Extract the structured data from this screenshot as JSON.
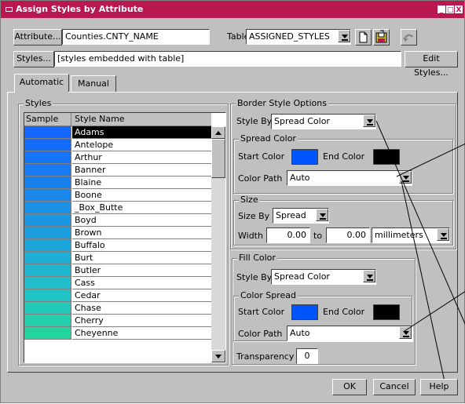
{
  "window": {
    "title": "Assign Styles by Attribute",
    "minimize_glyph": "_",
    "maximize_glyph": "□",
    "close_glyph": "X"
  },
  "top": {
    "attribute_button": "Attribute...",
    "attribute_value": "Counties.CNTY_NAME",
    "table_label": "Table",
    "table_value": "ASSIGNED_STYLES",
    "styles_button": "Styles...",
    "styles_value": "[styles embedded with table]",
    "edit_styles_button": "Edit Styles..."
  },
  "tabs": [
    {
      "label": "Automatic",
      "active": true
    },
    {
      "label": "Manual",
      "active": false
    }
  ],
  "styles_group": {
    "title": "Styles",
    "col_sample": "Sample",
    "col_name": "Style Name",
    "rows": [
      {
        "name": "Adams",
        "color": "#1466ff",
        "selected": true
      },
      {
        "name": "Antelope",
        "color": "#146cfb"
      },
      {
        "name": "Arthur",
        "color": "#1573f6"
      },
      {
        "name": "Banner",
        "color": "#177af2"
      },
      {
        "name": "Blaine",
        "color": "#1881ee"
      },
      {
        "name": "Boone",
        "color": "#1988ea"
      },
      {
        "name": "_Box_Butte",
        "color": "#1a90e6"
      },
      {
        "name": "Boyd",
        "color": "#1b97e2"
      },
      {
        "name": "Brown",
        "color": "#1c9ede"
      },
      {
        "name": "Buffalo",
        "color": "#1da6da"
      },
      {
        "name": "Burt",
        "color": "#1eaed5"
      },
      {
        "name": "Butler",
        "color": "#1fb6d1"
      },
      {
        "name": "Cass",
        "color": "#20bdcc"
      },
      {
        "name": "Cedar",
        "color": "#21c4c5"
      },
      {
        "name": "Chase",
        "color": "#22c9b8"
      },
      {
        "name": "Cherry",
        "color": "#23cfaa"
      },
      {
        "name": "Cheyenne",
        "color": "#24d49e"
      }
    ]
  },
  "border_options": {
    "title": "Border Style Options",
    "style_by_label": "Style By",
    "style_by_value": "Spread Color",
    "spread_color": {
      "title": "Spread Color",
      "start_label": "Start Color",
      "start_color": "#0055ff",
      "end_label": "End Color",
      "end_color": "#000000",
      "path_label": "Color Path",
      "path_value": "Auto"
    },
    "size": {
      "title": "Size",
      "size_by_label": "Size By",
      "size_by_value": "Spread",
      "width_label": "Width",
      "width_from": "0.00",
      "to_label": "to",
      "width_to": "0.00",
      "units": "millimeters"
    }
  },
  "fill_color": {
    "title": "Fill Color",
    "style_by_label": "Style By",
    "style_by_value": "Spread Color",
    "color_spread": {
      "title": "Color Spread",
      "start_label": "Start Color",
      "start_color": "#0055ff",
      "end_label": "End Color",
      "end_color": "#000000",
      "path_label": "Color Path",
      "path_value": "Auto"
    },
    "transparency_label": "Transparency",
    "transparency_value": "0"
  },
  "footer": {
    "ok": "OK",
    "cancel": "Cancel",
    "help": "Help"
  }
}
